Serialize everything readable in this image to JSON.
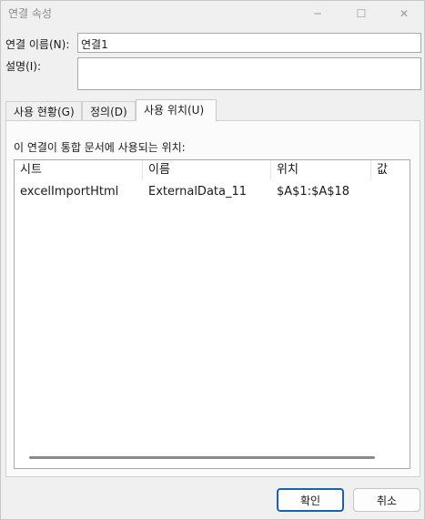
{
  "window": {
    "title": "연결 속성",
    "minimize_glyph": "─",
    "maximize_glyph": "☐",
    "close_glyph": "✕"
  },
  "form": {
    "name_label": "연결 이름(N):",
    "name_value": "연결1",
    "description_label": "설명(I):",
    "description_value": ""
  },
  "tabs": [
    {
      "label": "사용 현황(G)"
    },
    {
      "label": "정의(D)"
    },
    {
      "label": "사용 위치(U)",
      "active": true
    }
  ],
  "panel": {
    "caption": "이 연결이 통합 문서에 사용되는 위치:",
    "columns": [
      "시트",
      "이름",
      "위치",
      "값"
    ],
    "rows": [
      [
        "excelImportHtml",
        "ExternalData_11",
        "$A$1:$A$18",
        ""
      ]
    ]
  },
  "buttons": {
    "ok": "확인",
    "cancel": "취소"
  }
}
